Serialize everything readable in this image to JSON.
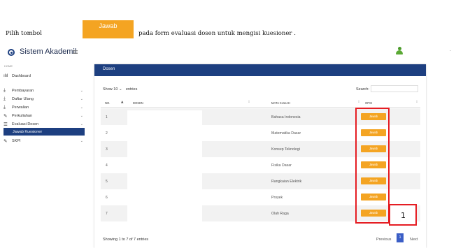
{
  "instruction": {
    "prefix": "Pilih tombol",
    "button_label": "Jawab",
    "suffix": "pada form evaluasi dosen untuk mengisi kuesioner ."
  },
  "app": {
    "title": "Sistem Akademil",
    "menu_icon": "≡",
    "user_caret": "-"
  },
  "sidebar": {
    "home_label": "HOME",
    "items": [
      {
        "label": "Dashboard",
        "icon": "chart-icon",
        "glyph": "ılıl",
        "chevron": ""
      },
      {
        "label": "Pembayaran",
        "icon": "download-icon",
        "glyph": "⤓",
        "chevron": "⌄"
      },
      {
        "label": "Daftar Ulang",
        "icon": "download-icon",
        "glyph": "⤓",
        "chevron": "⌄"
      },
      {
        "label": "Perwalian",
        "icon": "download-icon",
        "glyph": "⤓",
        "chevron": "⌄"
      },
      {
        "label": "Perkuliahan",
        "icon": "pencil-icon",
        "glyph": "✎",
        "chevron": "⌄"
      },
      {
        "label": "Evaluasi Dosen",
        "icon": "list-icon",
        "glyph": "☰",
        "chevron": "⌄"
      },
      {
        "label": "Jawab Kuesioner",
        "icon": "",
        "glyph": "",
        "chevron": ""
      },
      {
        "label": "SKPI",
        "icon": "pencil-icon",
        "glyph": "✎",
        "chevron": "⌄"
      }
    ]
  },
  "card": {
    "title": "Dosen",
    "show_prefix": "Show",
    "show_value": "10",
    "show_suffix": "entries",
    "search_label": "Search:",
    "columns": [
      "NO.",
      "DOSEN",
      "MATA KULIAH",
      "OPSI"
    ],
    "rows": [
      {
        "no": "1",
        "mata_kuliah": "Bahasa Indonesia",
        "action": "Jawab"
      },
      {
        "no": "2",
        "mata_kuliah": "Matematika Dasar",
        "action": "Jawab"
      },
      {
        "no": "3",
        "mata_kuliah": "Konsep Teknologi",
        "action": "Jawab"
      },
      {
        "no": "4",
        "mata_kuliah": "Fisika Dasar",
        "action": "Jawab"
      },
      {
        "no": "5",
        "mata_kuliah": "Rangkaian Elektrik",
        "action": "Jawab"
      },
      {
        "no": "6",
        "mata_kuliah": "Proyek",
        "action": "Jawab"
      },
      {
        "no": "7",
        "mata_kuliah": "Olah Raga",
        "action": "Jawab"
      }
    ],
    "footer_info": "Showing 1 to 7 of 7 entries",
    "pagination": {
      "prev": "Previous",
      "current": "1",
      "next": "Next"
    }
  },
  "annotation": {
    "number": "1"
  },
  "colors": {
    "accent": "#1d3f80",
    "button": "#f4a422",
    "highlight": "#e51d23"
  }
}
